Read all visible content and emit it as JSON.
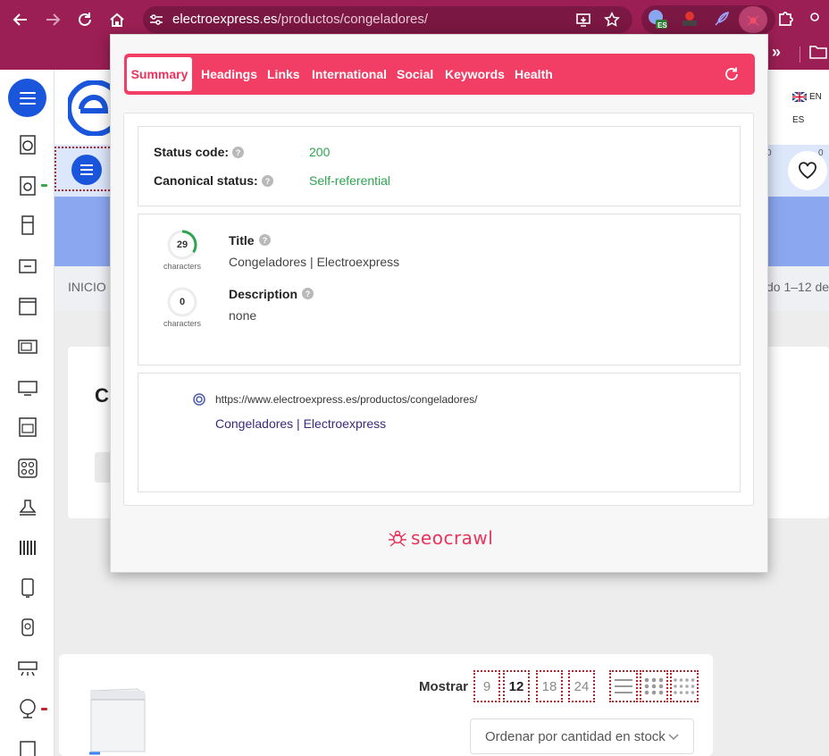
{
  "browser": {
    "url_domain": "electroexpress.es",
    "url_path": "/productos/congeladores/",
    "ext_badge": "ES",
    "overflow": "»"
  },
  "site": {
    "lang_en": "EN",
    "lang_es": "ES",
    "breadcrumb": "INICIO",
    "results_fragment": "do 1–12 de",
    "counter_a": "0",
    "counter_b": "0",
    "card_letter": "C",
    "mostrar_label": "Mostrar",
    "per_page_options": [
      "9",
      "12",
      "18",
      "24"
    ],
    "per_page_selected": "12",
    "sort_selected": "Ordenar por cantidad en stock"
  },
  "seo": {
    "tabs": [
      "Summary",
      "Headings",
      "Links",
      "International",
      "Social",
      "Keywords",
      "Health"
    ],
    "active_tab": "Summary",
    "status_code_label": "Status code:",
    "status_code_value": "200",
    "canonical_label": "Canonical status:",
    "canonical_value": "Self-referential",
    "title_label": "Title",
    "title_count": "29",
    "title_value": "Congeladores | Electroexpress",
    "description_label": "Description",
    "description_count": "0",
    "description_value": "none",
    "characters_caption": "characters",
    "help_glyph": "?",
    "serp_url": "https://www.electroexpress.es/productos/congeladores/",
    "serp_title": "Congeladores | Electroexpress",
    "brand": "seocrawl"
  },
  "colors": {
    "chrome": "#9b1f54",
    "tab_bar": "#f23d64",
    "status_green": "#2ea44f",
    "site_blue": "#1a56db"
  }
}
